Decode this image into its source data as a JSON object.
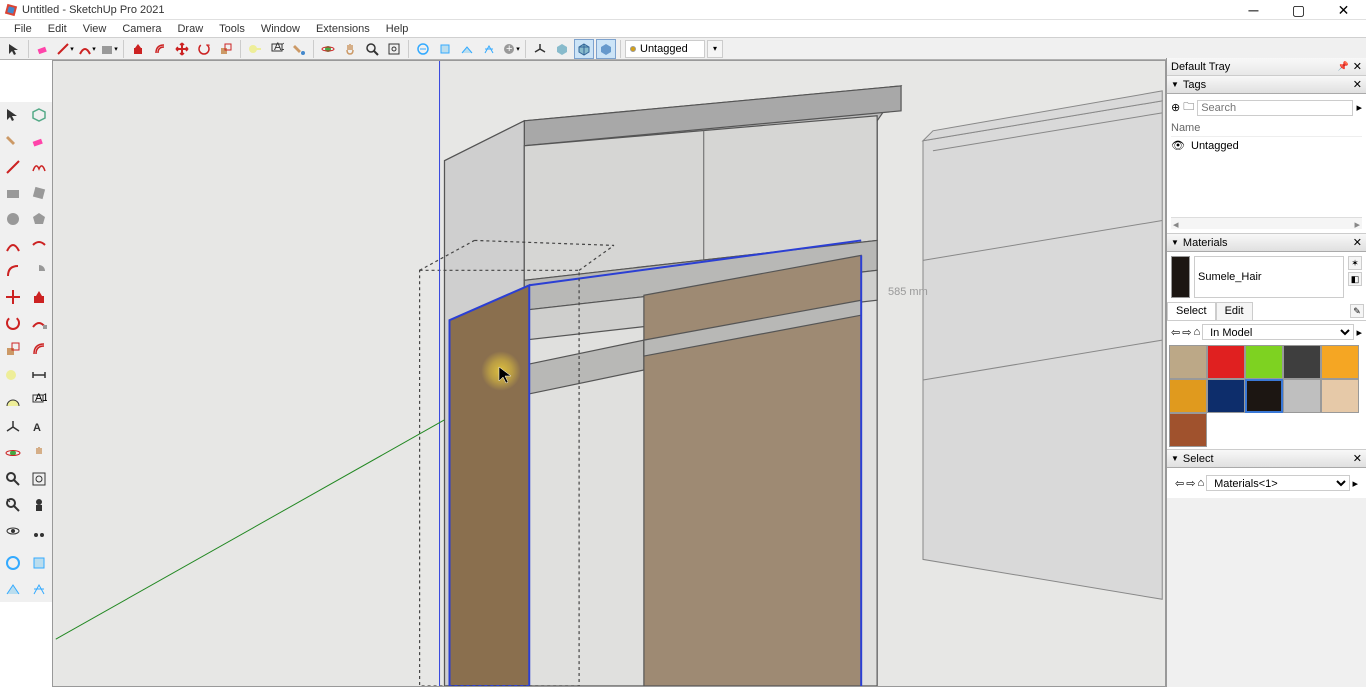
{
  "window": {
    "title": "Untitled - SketchUp Pro 2021"
  },
  "menu": {
    "items": [
      "File",
      "Edit",
      "View",
      "Camera",
      "Draw",
      "Tools",
      "Window",
      "Extensions",
      "Help"
    ]
  },
  "topToolbar": {
    "tagField": "Untagged"
  },
  "tray": {
    "title": "Default Tray"
  },
  "tagsPanel": {
    "title": "Tags",
    "searchPlaceholder": "Search",
    "columnHeader": "Name",
    "rows": [
      {
        "name": "Untagged"
      }
    ]
  },
  "materialsPanel": {
    "title": "Materials",
    "currentName": "Sumele_Hair",
    "tabs": {
      "select": "Select",
      "edit": "Edit"
    },
    "libraryDropdown": "In Model",
    "swatches": [
      {
        "color": "#bca887"
      },
      {
        "color": "#e02020"
      },
      {
        "color": "#7ed221"
      },
      {
        "color": "#3e3e3e"
      },
      {
        "color": "#f5a623"
      },
      {
        "color": "#e09a1e"
      },
      {
        "color": "#0d2d6b"
      },
      {
        "color": "#1c1612",
        "selected": true
      },
      {
        "color": "#bfbfbf"
      },
      {
        "color": "#e6c9a8"
      },
      {
        "color": "#a0522d"
      }
    ]
  },
  "selectPanel": {
    "title": "Select",
    "dropdown": "Materials<1>"
  },
  "viewport": {
    "dimension": "585 mm"
  }
}
